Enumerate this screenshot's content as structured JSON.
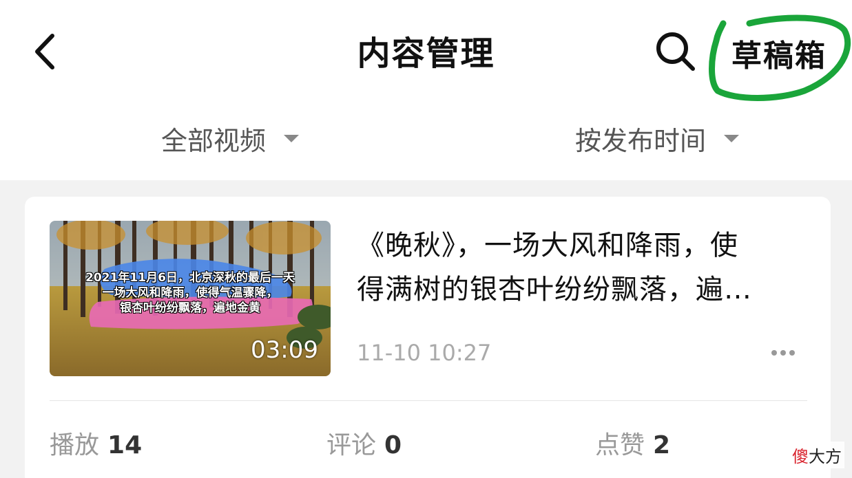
{
  "header": {
    "title": "内容管理",
    "drafts_label": "草稿箱",
    "back_icon": "chevron-left-icon",
    "search_icon": "search-icon",
    "highlight_color": "#1aa53a"
  },
  "filters": {
    "type_label": "全部视频",
    "sort_label": "按发布时间"
  },
  "video": {
    "title_line1": "《晚秋》，一场大风和降雨，使",
    "title_line2": "得满树的银杏叶纷纷飘落，遍…",
    "date": "11-10 10:27",
    "duration": "03:09",
    "thumbnail_caption": [
      "2021年11月6日，北京深秋的最后一天",
      "一场大风和降雨，使得气温骤降，",
      "银杏叶纷纷飘落，遍地金黄"
    ]
  },
  "stats": {
    "plays_label": "播放",
    "plays": "14",
    "comments_label": "评论",
    "comments": "0",
    "likes_label": "点赞",
    "likes": "2"
  },
  "watermark": {
    "red_char": "傻",
    "rest": "大方"
  }
}
